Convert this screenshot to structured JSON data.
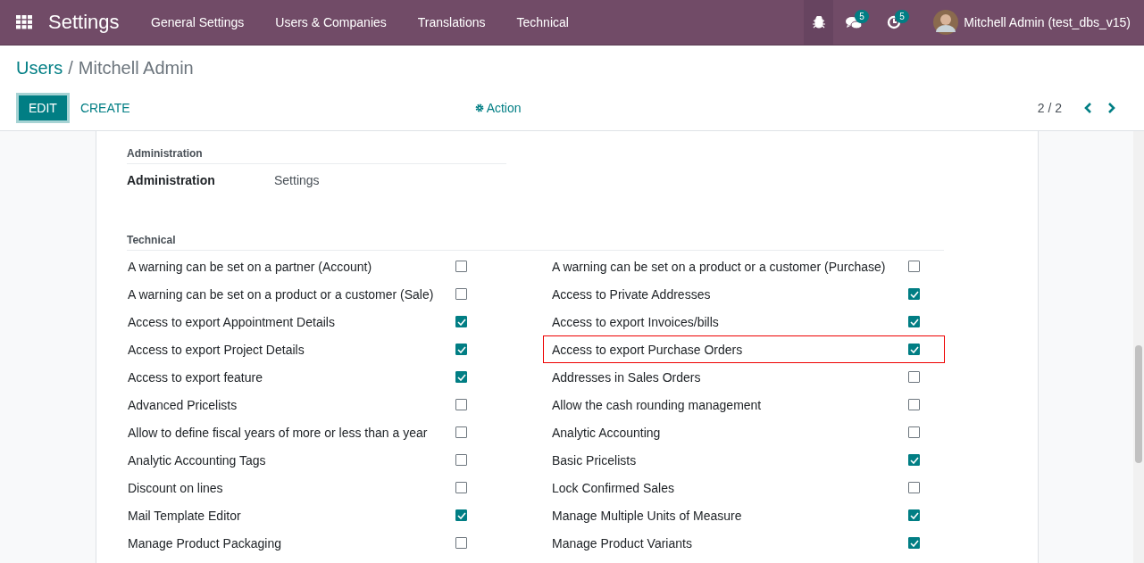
{
  "navbar": {
    "app_title": "Settings",
    "menu": [
      "General Settings",
      "Users & Companies",
      "Translations",
      "Technical"
    ],
    "debug_active": true,
    "messages_badge": "5",
    "activities_badge": "5",
    "user": "Mitchell Admin (test_dbs_v15)"
  },
  "breadcrumb": {
    "parent": "Users",
    "separator": "/",
    "current": "Mitchell Admin"
  },
  "buttons": {
    "edit": "EDIT",
    "create": "CREATE",
    "action": "Action"
  },
  "pager": {
    "value": "2 / 2"
  },
  "administration": {
    "heading": "Administration",
    "label": "Administration",
    "value": "Settings"
  },
  "technical": {
    "heading": "Technical",
    "rows": [
      {
        "left": {
          "label": "A warning can be set on a partner (Account)",
          "checked": false,
          "highlighted": false
        },
        "right": {
          "label": "A warning can be set on a product or a customer (Purchase)",
          "checked": false,
          "highlighted": false
        }
      },
      {
        "left": {
          "label": "A warning can be set on a product or a customer (Sale)",
          "checked": false,
          "highlighted": false
        },
        "right": {
          "label": "Access to Private Addresses",
          "checked": true,
          "highlighted": false
        }
      },
      {
        "left": {
          "label": "Access to export Appointment Details",
          "checked": true,
          "highlighted": false
        },
        "right": {
          "label": "Access to export Invoices/bills",
          "checked": true,
          "highlighted": false
        }
      },
      {
        "left": {
          "label": "Access to export Project Details",
          "checked": true,
          "highlighted": false
        },
        "right": {
          "label": "Access to export Purchase Orders",
          "checked": true,
          "highlighted": true
        }
      },
      {
        "left": {
          "label": "Access to export feature",
          "checked": true,
          "highlighted": false
        },
        "right": {
          "label": "Addresses in Sales Orders",
          "checked": false,
          "highlighted": false
        }
      },
      {
        "left": {
          "label": "Advanced Pricelists",
          "checked": false,
          "highlighted": false
        },
        "right": {
          "label": "Allow the cash rounding management",
          "checked": false,
          "highlighted": false
        }
      },
      {
        "left": {
          "label": "Allow to define fiscal years of more or less than a year",
          "checked": false,
          "highlighted": false
        },
        "right": {
          "label": "Analytic Accounting",
          "checked": false,
          "highlighted": false
        }
      },
      {
        "left": {
          "label": "Analytic Accounting Tags",
          "checked": false,
          "highlighted": false
        },
        "right": {
          "label": "Basic Pricelists",
          "checked": true,
          "highlighted": false
        }
      },
      {
        "left": {
          "label": "Discount on lines",
          "checked": false,
          "highlighted": false
        },
        "right": {
          "label": "Lock Confirmed Sales",
          "checked": false,
          "highlighted": false
        }
      },
      {
        "left": {
          "label": "Mail Template Editor",
          "checked": true,
          "highlighted": false
        },
        "right": {
          "label": "Manage Multiple Units of Measure",
          "checked": true,
          "highlighted": false
        }
      },
      {
        "left": {
          "label": "Manage Product Packaging",
          "checked": false,
          "highlighted": false
        },
        "right": {
          "label": "Manage Product Variants",
          "checked": true,
          "highlighted": false
        }
      }
    ]
  }
}
